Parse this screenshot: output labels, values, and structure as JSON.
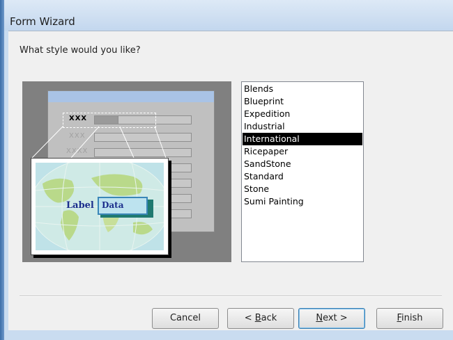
{
  "window": {
    "title": "Form Wizard"
  },
  "prompt": "What style would you like?",
  "preview": {
    "mock_labels": [
      "XXX",
      "XXX",
      "XXXX"
    ],
    "card_label": "Label",
    "card_data": "Data"
  },
  "styles": {
    "items": [
      "Blends",
      "Blueprint",
      "Expedition",
      "Industrial",
      "International",
      "Ricepaper",
      "SandStone",
      "Standard",
      "Stone",
      "Sumi Painting"
    ],
    "selected": "International"
  },
  "buttons": {
    "cancel": "Cancel",
    "back_prefix": "< ",
    "back_accel": "B",
    "back_rest": "ack",
    "next_accel": "N",
    "next_rest": "ext >",
    "finish_accel": "F",
    "finish_rest": "inish"
  },
  "colors": {
    "selection": "#000000",
    "list_background": "#ffffff",
    "dialog_background": "#f0f0f0"
  }
}
